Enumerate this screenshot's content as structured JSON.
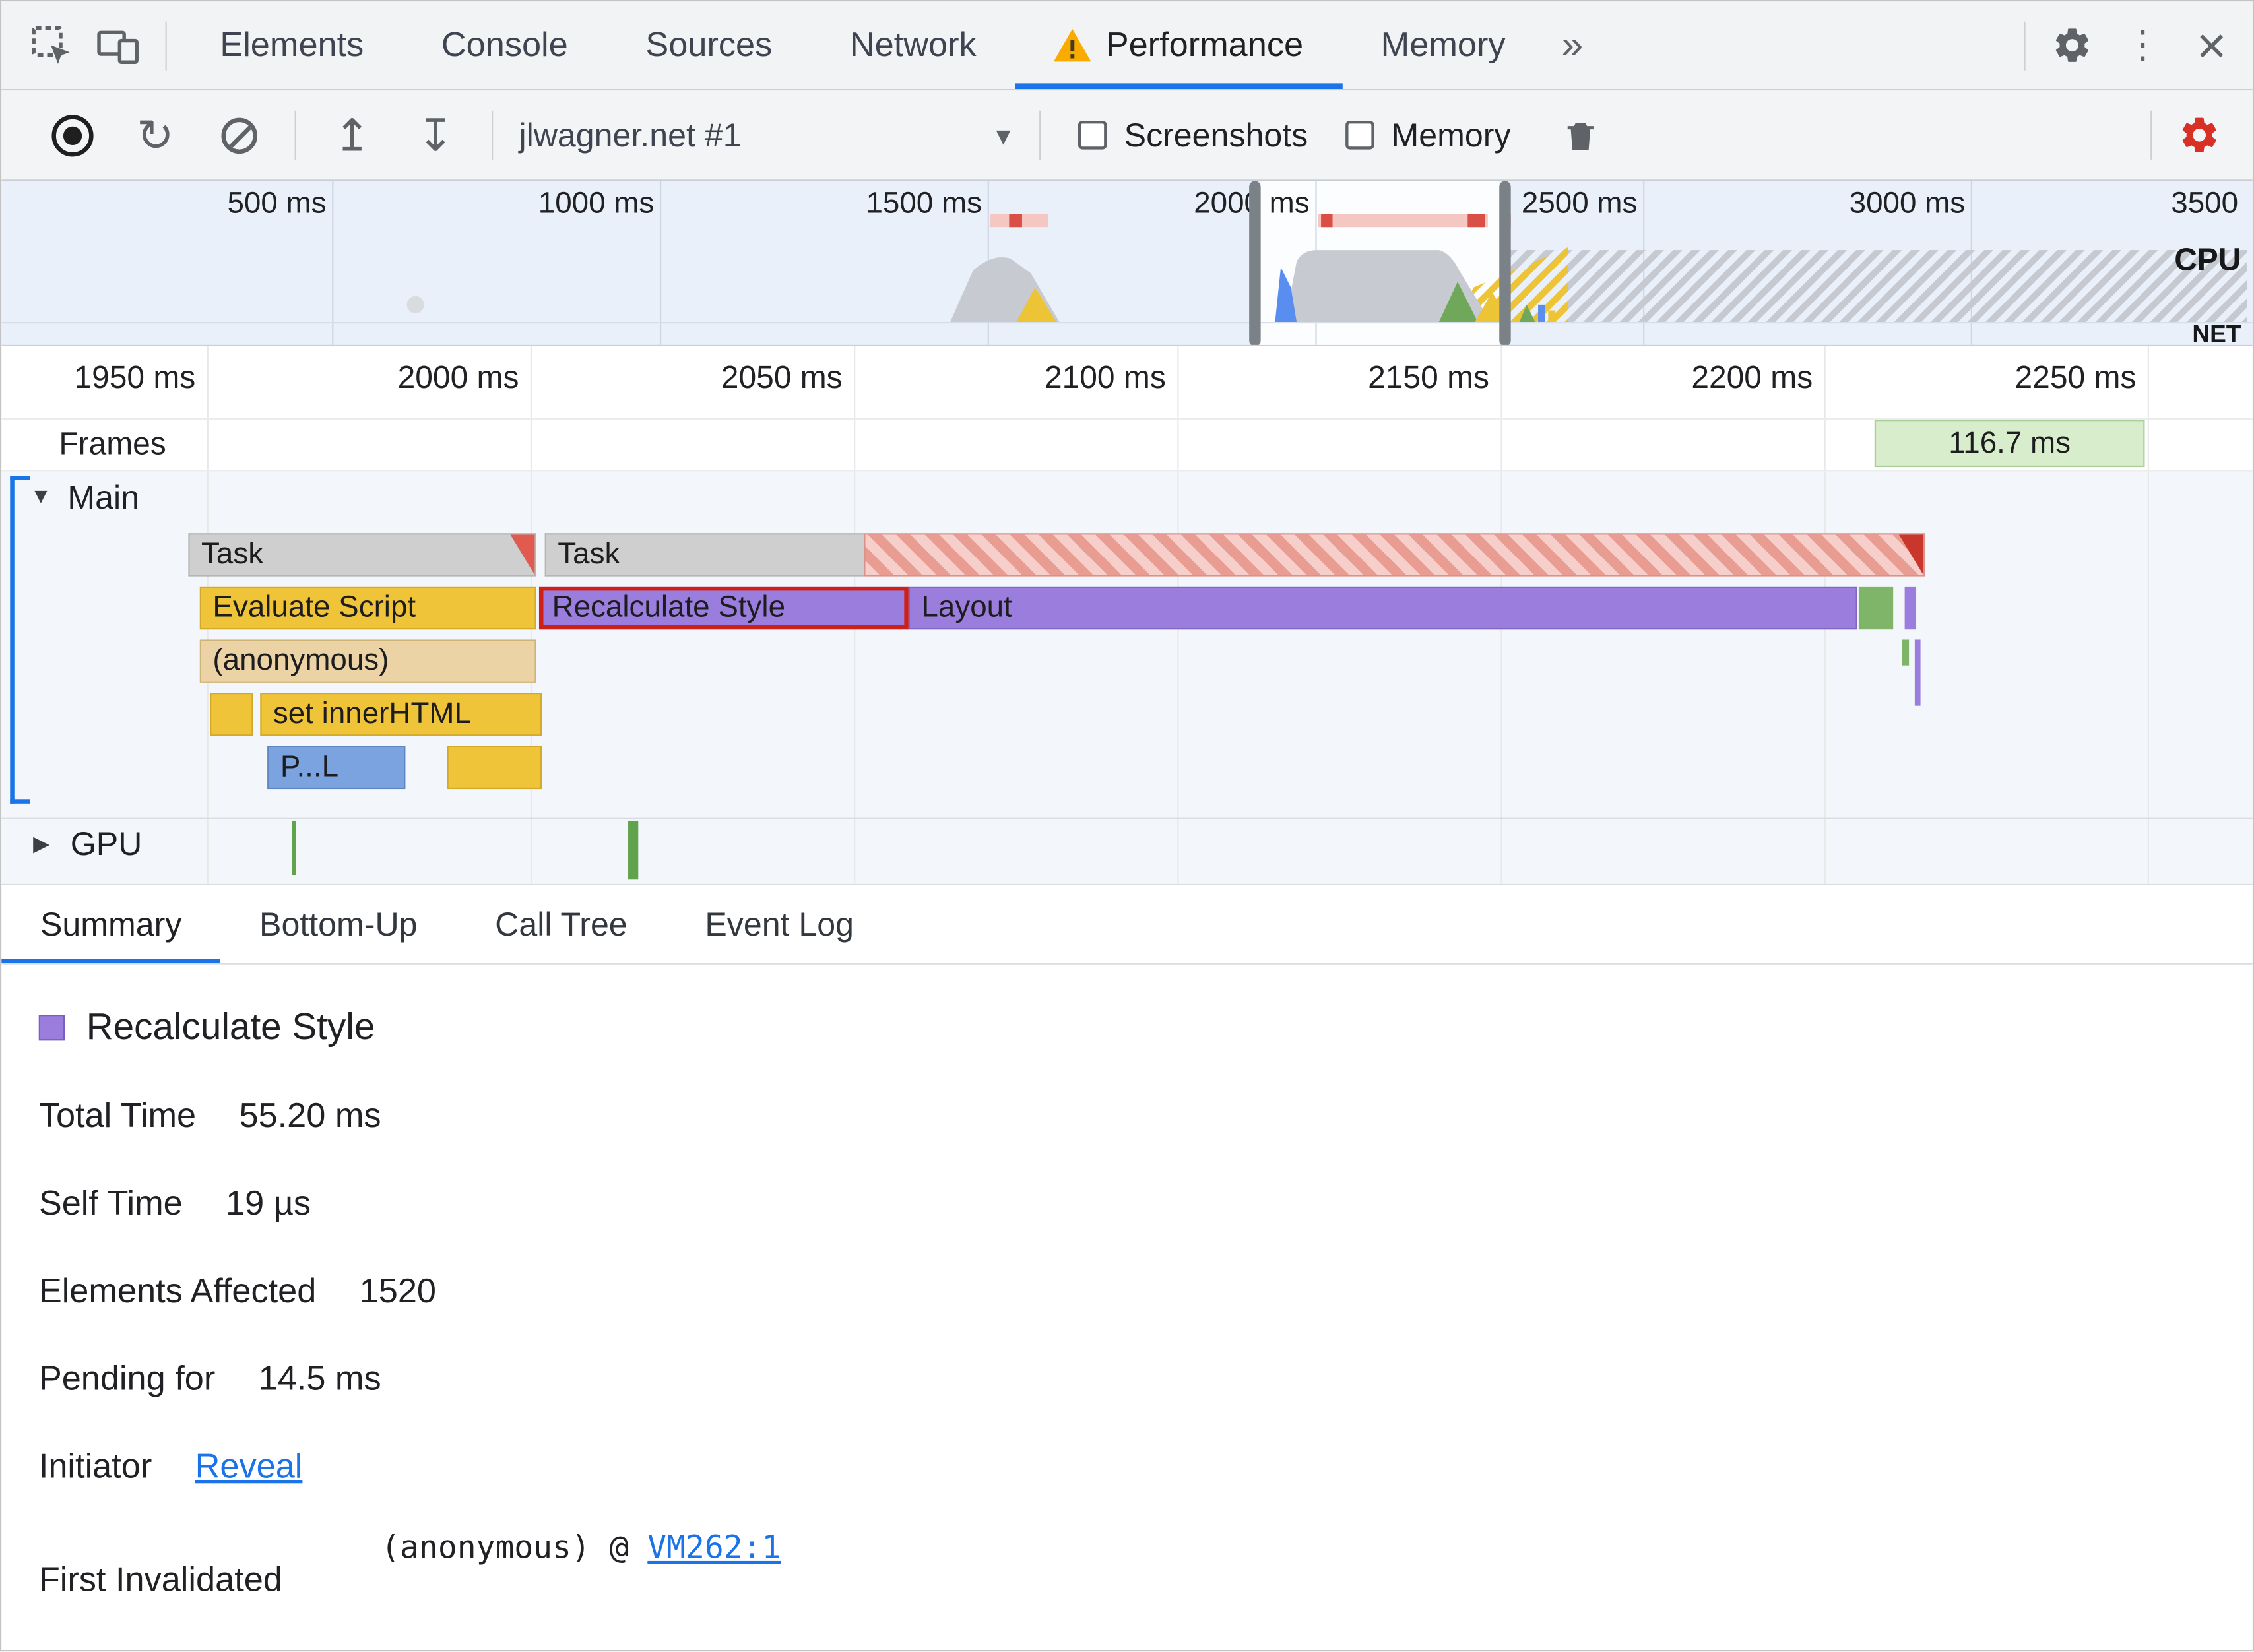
{
  "devtools": {
    "tabs": [
      "Elements",
      "Console",
      "Sources",
      "Network",
      "Performance",
      "Memory"
    ],
    "more_tabs_glyph": "»",
    "menu_glyph": "⋮",
    "close_glyph": "×"
  },
  "perf_toolbar": {
    "profile_name": "jlwagner.net #1",
    "caret_glyph": "▾",
    "screenshots_label": "Screenshots",
    "memory_label": "Memory",
    "reload_glyph": "↻",
    "load_glyph": "↥",
    "save_glyph": "↧"
  },
  "overview": {
    "ruler_labels": [
      "500 ms",
      "1000 ms",
      "1500 ms",
      "2000 ms",
      "2500 ms",
      "3000 ms",
      "3500"
    ],
    "cpu_label": "CPU",
    "net_label": "NET"
  },
  "timeline": {
    "ruler_labels": [
      "1950 ms",
      "2000 ms",
      "2050 ms",
      "2100 ms",
      "2150 ms",
      "2200 ms",
      "2250 ms"
    ],
    "frames_label": "Frames",
    "frame_duration": "116.7 ms",
    "main_track": {
      "label": "Main",
      "expand_glyph": "▼"
    },
    "gpu_track": {
      "label": "GPU",
      "expand_glyph": "▶"
    },
    "events": {
      "task": "Task",
      "evaluate_script": "Evaluate Script",
      "recalculate_style": "Recalculate Style",
      "layout": "Layout",
      "anonymous": "(anonymous)",
      "set_inner_html": "set innerHTML",
      "profile_call_truncated": "P...L"
    }
  },
  "bottom_tabs": [
    "Summary",
    "Bottom-Up",
    "Call Tree",
    "Event Log"
  ],
  "summary": {
    "event_title": "Recalculate Style",
    "total_time_label": "Total Time",
    "total_time_value": "55.20 ms",
    "self_time_label": "Self Time",
    "self_time_value": "19 µs",
    "elements_affected_label": "Elements Affected",
    "elements_affected_value": "1520",
    "pending_for_label": "Pending for",
    "pending_for_value": "14.5 ms",
    "initiator_label": "Initiator",
    "initiator_link": "Reveal",
    "first_invalidated_label": "First Invalidated",
    "stack_frame": "(anonymous) @ ",
    "stack_link": "VM262:1"
  },
  "colors": {
    "accent_blue": "#1a73e8",
    "selection_red": "#cf2018",
    "scripting_yellow": "#efc439",
    "rendering_purple": "#9b7ddd",
    "painting_green": "#7fb569",
    "task_gray": "#cfcfcf",
    "warning_orange": "#f9ab00",
    "settings_alert_red": "#d93025"
  }
}
